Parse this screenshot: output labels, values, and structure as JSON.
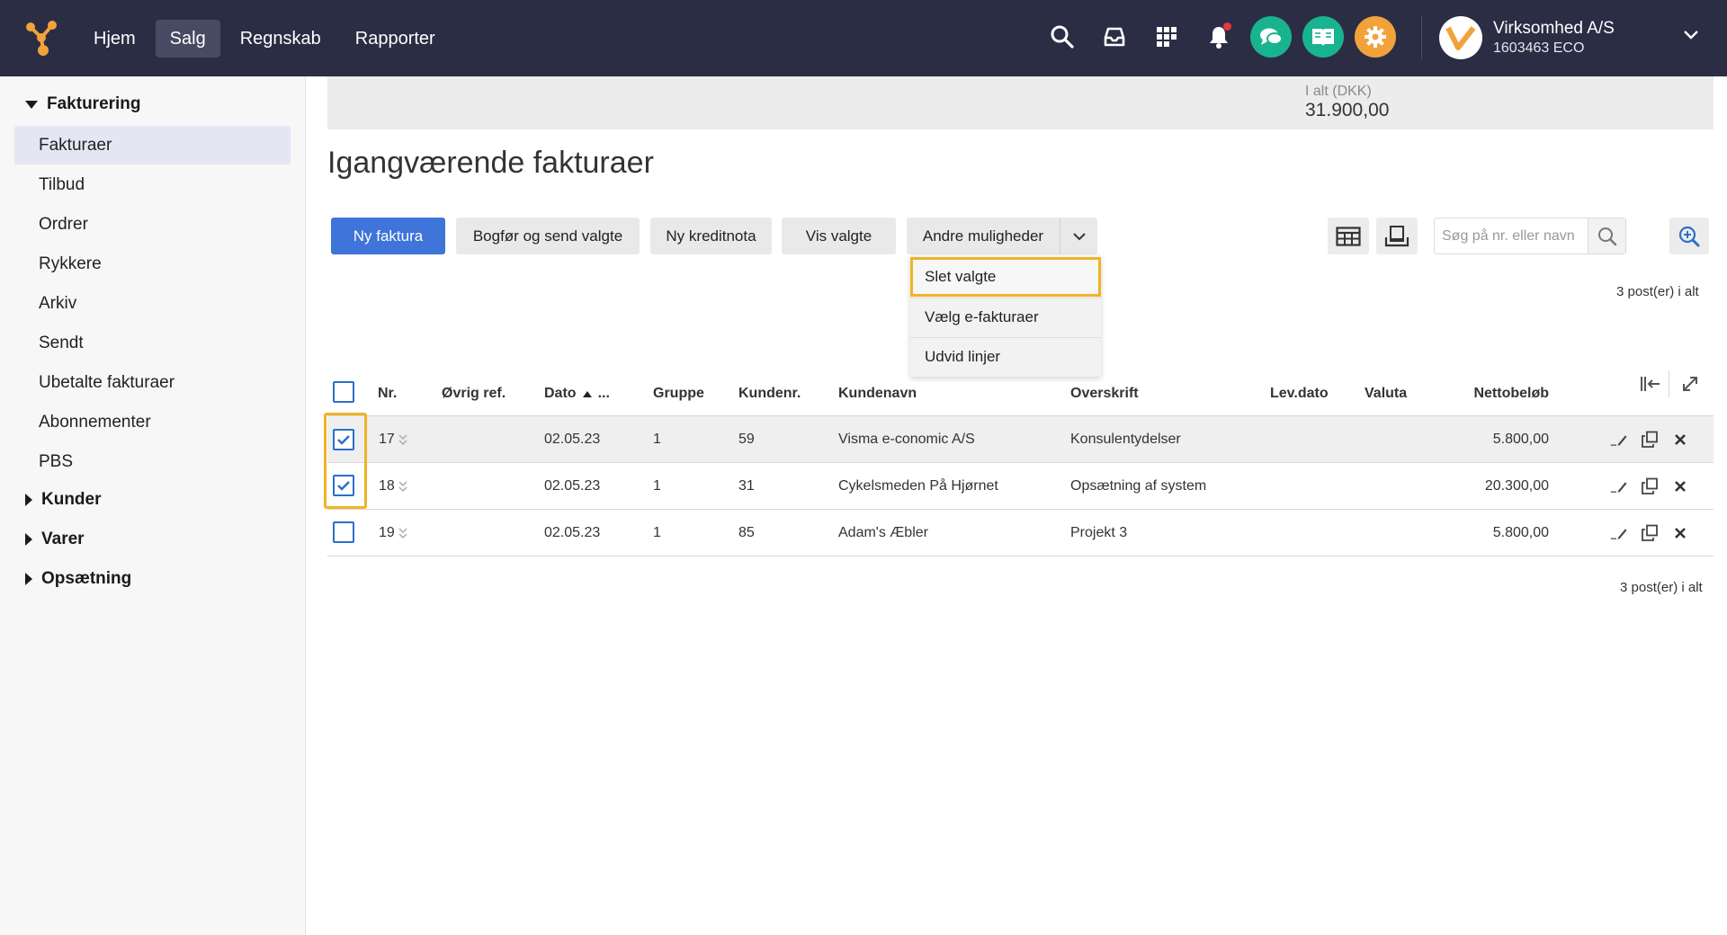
{
  "nav": {
    "items": [
      {
        "label": "Hjem",
        "active": false
      },
      {
        "label": "Salg",
        "active": true
      },
      {
        "label": "Regnskab",
        "active": false
      },
      {
        "label": "Rapporter",
        "active": false
      }
    ]
  },
  "topbar_icons": [
    "search-icon",
    "inbox-icon",
    "apps-grid-icon",
    "bell-icon",
    "chat-icon",
    "book-icon",
    "gear-icon"
  ],
  "company": {
    "name": "Virksomhed A/S",
    "id": "1603463 ECO"
  },
  "colors": {
    "topbar": "#2b2d45",
    "primary": "#3f74d9",
    "highlight": "#f0b323",
    "green": "#19b38f",
    "orange": "#f2a23a"
  },
  "sidebar": {
    "groups": [
      {
        "label": "Fakturering",
        "expanded": true
      },
      {
        "label": "Kunder",
        "expanded": false
      },
      {
        "label": "Varer",
        "expanded": false
      },
      {
        "label": "Opsætning",
        "expanded": false
      }
    ],
    "items": [
      {
        "label": "Fakturaer",
        "active": true
      },
      {
        "label": "Tilbud"
      },
      {
        "label": "Ordrer"
      },
      {
        "label": "Rykkere"
      },
      {
        "label": "Arkiv"
      },
      {
        "label": "Sendt"
      },
      {
        "label": "Ubetalte fakturaer"
      },
      {
        "label": "Abonnementer"
      },
      {
        "label": "PBS"
      }
    ]
  },
  "summary": {
    "label": "I alt (DKK)",
    "value": "31.900,00"
  },
  "page": {
    "title": "Igangværende fakturaer"
  },
  "toolbar": {
    "new_invoice": "Ny faktura",
    "post_send": "Bogfør og send valgte",
    "new_credit": "Ny kreditnota",
    "show_selected": "Vis valgte",
    "other_options": "Andre muligheder"
  },
  "dropdown": {
    "items": [
      "Slet valgte",
      "Vælg e-fakturaer",
      "Udvid linjer"
    ],
    "highlighted": "Slet valgte"
  },
  "search": {
    "placeholder": "Søg på nr. eller navn",
    "value": ""
  },
  "count_text": "3 post(er) i alt",
  "table": {
    "headers": {
      "nr": "Nr.",
      "other_ref": "Øvrig ref.",
      "date": "Dato",
      "date_more": "...",
      "group": "Gruppe",
      "customer_no": "Kundenr.",
      "customer_name": "Kundenavn",
      "heading": "Overskrift",
      "delivery_date": "Lev.dato",
      "currency": "Valuta",
      "net_amount": "Nettobeløb"
    },
    "rows": [
      {
        "nr": "17",
        "other_ref": "",
        "date": "02.05.23",
        "group": "1",
        "customer_no": "59",
        "customer_name": "Visma e-conomic A/S",
        "heading": "Konsulentydelser",
        "delivery_date": "",
        "currency": "",
        "net_amount": "5.800,00",
        "checked": true
      },
      {
        "nr": "18",
        "other_ref": "",
        "date": "02.05.23",
        "group": "1",
        "customer_no": "31",
        "customer_name": "Cykelsmeden På Hjørnet",
        "heading": "Opsætning af system",
        "delivery_date": "",
        "currency": "",
        "net_amount": "20.300,00",
        "checked": true
      },
      {
        "nr": "19",
        "other_ref": "",
        "date": "02.05.23",
        "group": "1",
        "customer_no": "85",
        "customer_name": "Adam's Æbler",
        "heading": "Projekt 3",
        "delivery_date": "",
        "currency": "",
        "net_amount": "5.800,00",
        "checked": false
      }
    ]
  }
}
